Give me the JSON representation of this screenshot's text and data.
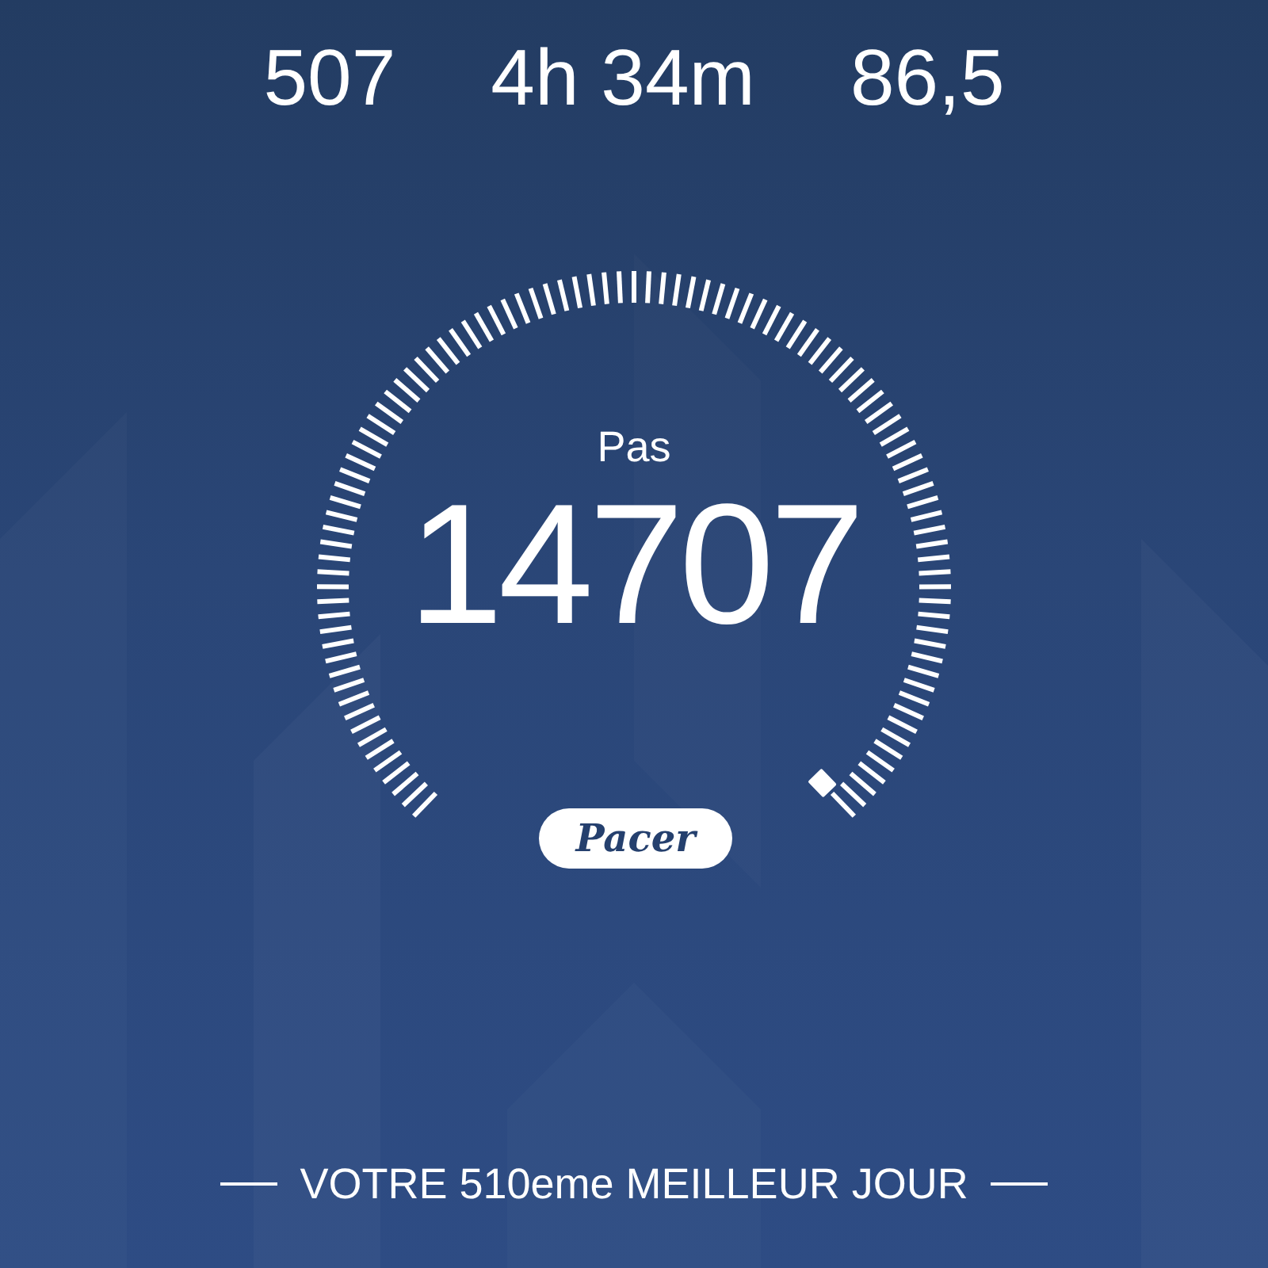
{
  "stats": [
    {
      "value": "507"
    },
    {
      "value": "4h 34m"
    },
    {
      "value": "86,5"
    }
  ],
  "gauge": {
    "label": "Pas",
    "value": "14707"
  },
  "logo": {
    "text": "Pacer"
  },
  "footer": {
    "text": "VOTRE 510eme MEILLEUR JOUR"
  }
}
